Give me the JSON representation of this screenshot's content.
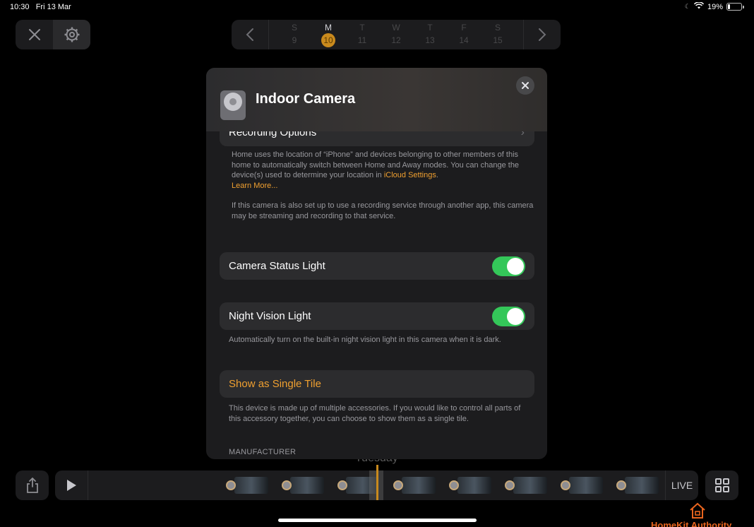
{
  "status_bar": {
    "time": "10:30",
    "date": "Fri 13 Mar",
    "battery": "19%",
    "battery_level": 0.19
  },
  "background": {
    "title_fragment": "",
    "day_label": "Tuesday"
  },
  "date_bar": {
    "days": [
      {
        "letter": "S",
        "num": "9"
      },
      {
        "letter": "M",
        "num": "10",
        "active": true
      },
      {
        "letter": "T",
        "num": "11"
      },
      {
        "letter": "W",
        "num": "12"
      },
      {
        "letter": "T",
        "num": "13"
      },
      {
        "letter": "F",
        "num": "14"
      },
      {
        "letter": "S",
        "num": "15"
      }
    ]
  },
  "modal": {
    "title": "Indoor Camera",
    "recording_options_label": "Recording Options",
    "location_note_1": "Home uses the location of “iPhone” and devices belonging to other members of this home to automatically switch between Home and Away modes. You can change the device(s) used to determine your location in",
    "icloud_link": "iCloud Settings",
    "location_note_end": ".",
    "learn_more": "Learn More...",
    "service_note": "If this camera is also set up to use a recording service through another app, this camera may be streaming and recording to that service.",
    "camera_status_light": {
      "label": "Camera Status Light",
      "on": true
    },
    "night_vision_light": {
      "label": "Night Vision Light",
      "on": true
    },
    "night_vision_note": "Automatically turn on the built-in night vision light in this camera when it is dark.",
    "single_tile_label": "Show as Single Tile",
    "single_tile_note": "This device is made up of multiple accessories. If you would like to control all parts of this accessory together, you can choose to show them as a single tile.",
    "manufacturer_header": "MANUFACTURER"
  },
  "timeline": {
    "live_label": "LIVE"
  },
  "watermark": {
    "text": "HomeKit Authority"
  },
  "colors": {
    "accent": "#f0a030",
    "toggle_on": "#34c759",
    "date_active": "#c98a1d"
  }
}
